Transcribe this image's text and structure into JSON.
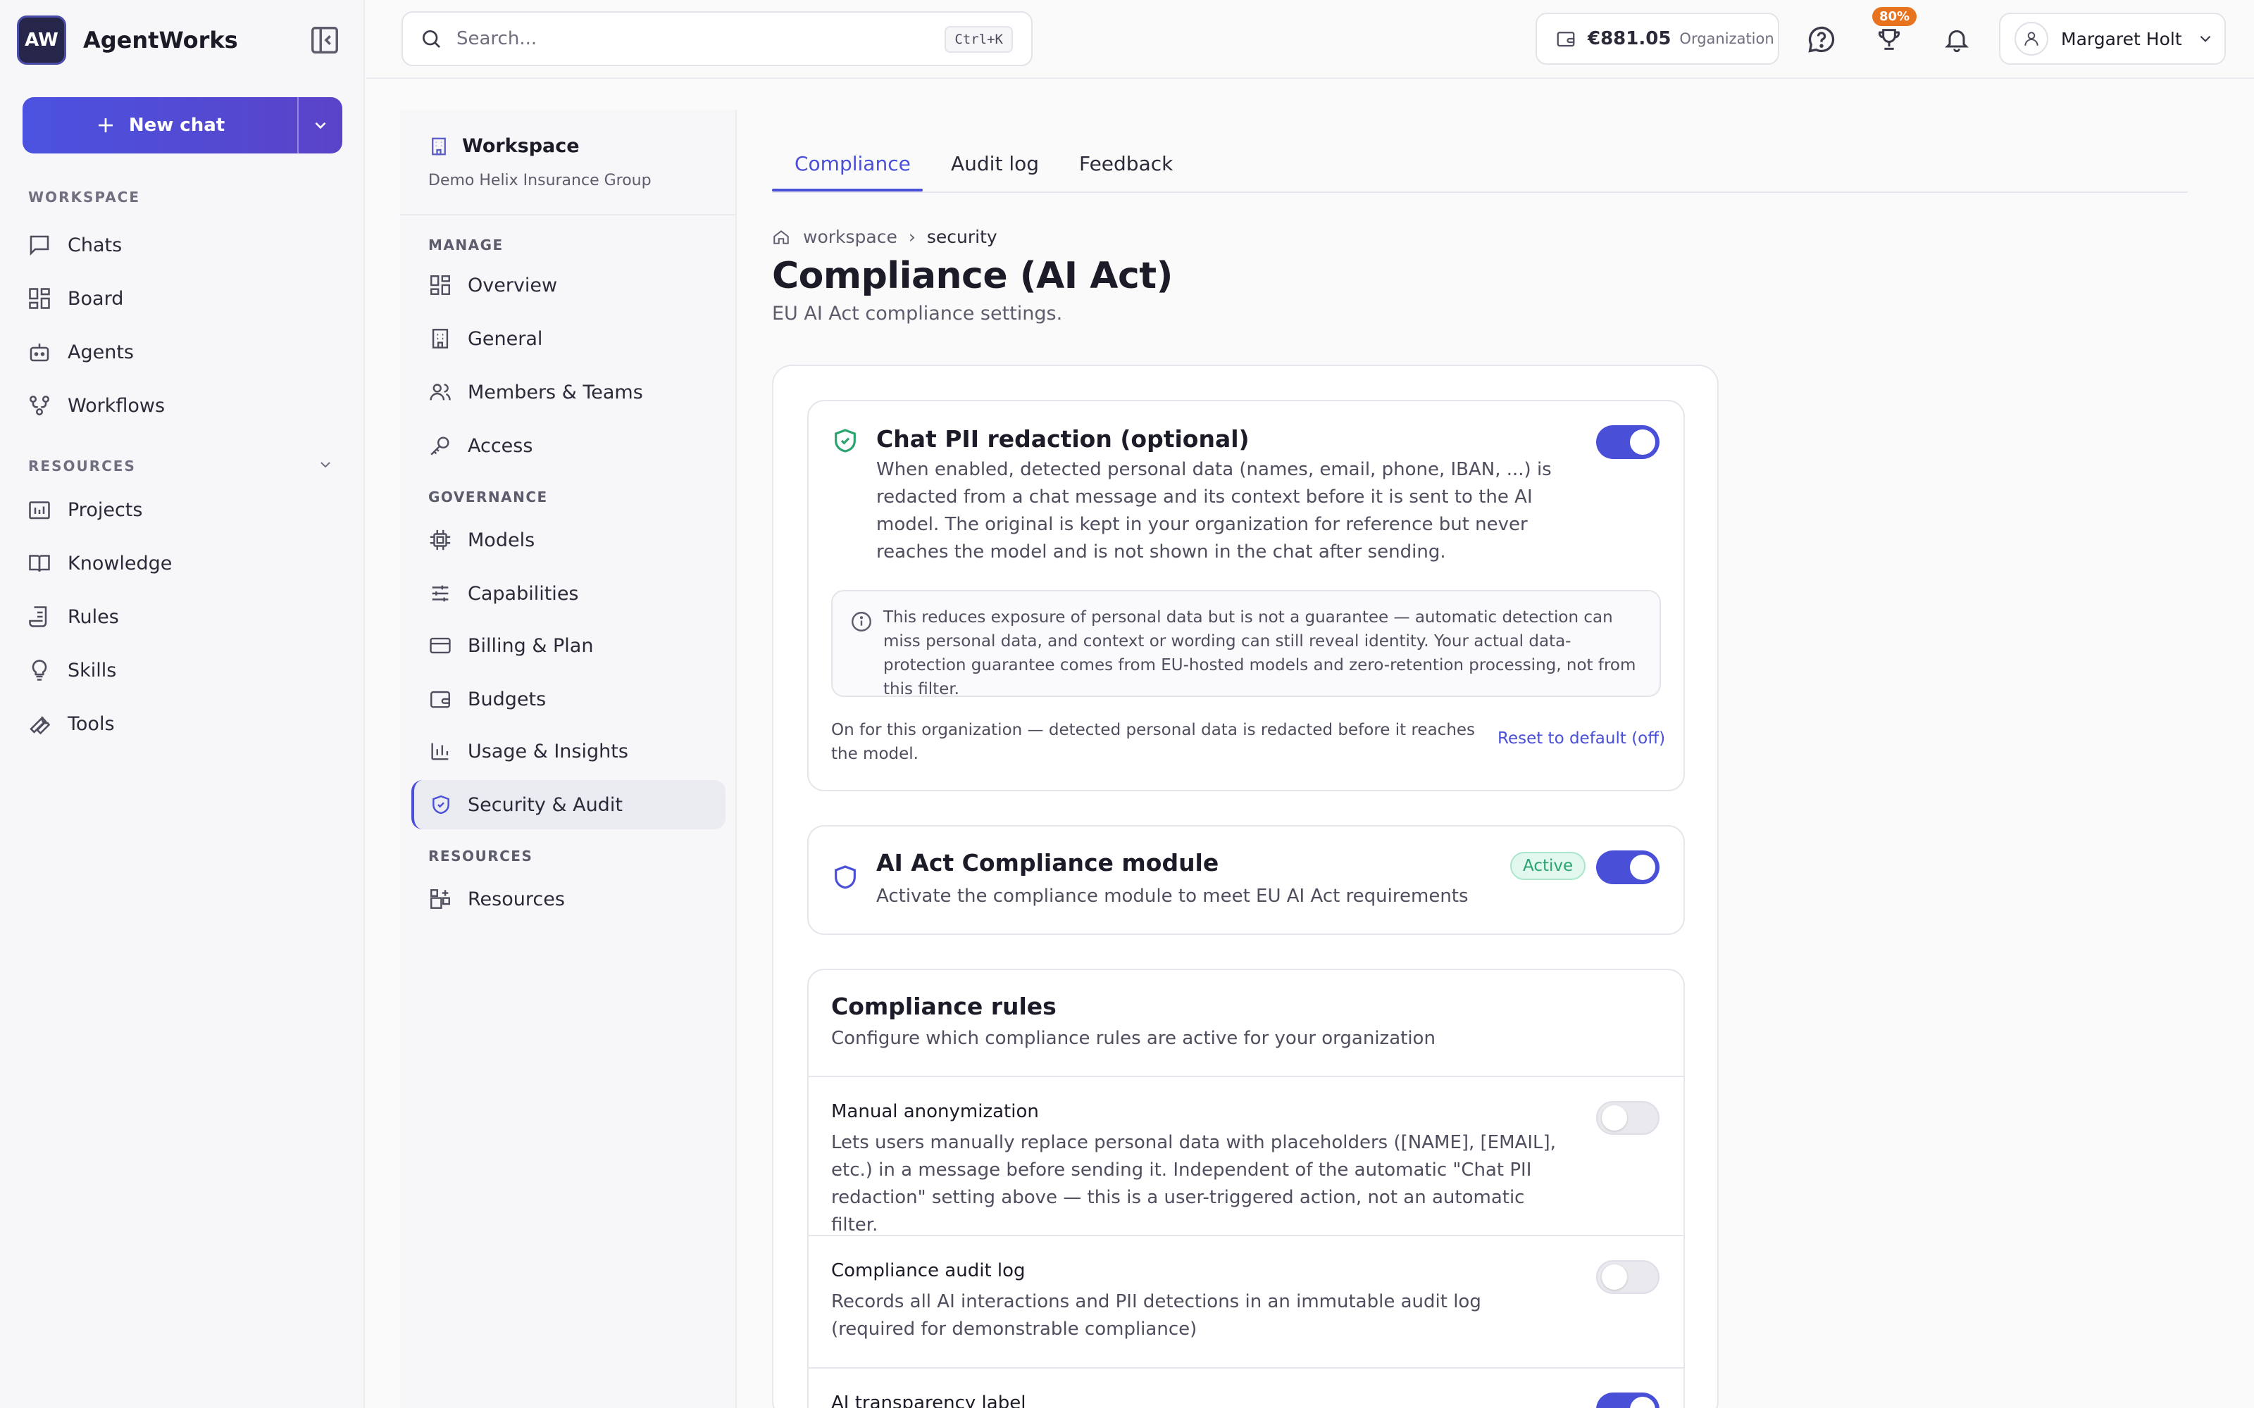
{
  "app": {
    "logo_text": "AW",
    "name": "AgentWorks"
  },
  "sidebar": {
    "new_chat_label": "New chat",
    "workspace_section": "WORKSPACE",
    "workspace_items": [
      "Chats",
      "Board",
      "Agents",
      "Workflows"
    ],
    "resources_section": "RESOURCES",
    "resources_items": [
      "Projects",
      "Knowledge",
      "Rules",
      "Skills",
      "Tools"
    ]
  },
  "topbar": {
    "search_placeholder": "Search...",
    "search_shortcut": "Ctrl+K",
    "balance_amount": "€881.05",
    "balance_scope": "Organization",
    "notification_badge": "80%",
    "user_name": "Margaret Holt"
  },
  "subnav": {
    "workspace_title": "Workspace",
    "workspace_org": "Demo Helix Insurance Group",
    "manage_section": "MANAGE",
    "manage_items": [
      "Overview",
      "General",
      "Members & Teams",
      "Access"
    ],
    "governance_section": "GOVERNANCE",
    "governance_items": [
      "Models",
      "Capabilities",
      "Billing & Plan",
      "Budgets",
      "Usage & Insights",
      "Security & Audit"
    ],
    "resources_section": "RESOURCES",
    "resources_items": [
      "Resources"
    ]
  },
  "tabs": [
    "Compliance",
    "Audit log",
    "Feedback"
  ],
  "breadcrumb": {
    "root": "workspace",
    "current": "security"
  },
  "page": {
    "title": "Compliance (AI Act)",
    "subtitle": "EU AI Act compliance settings."
  },
  "pii_card": {
    "title": "Chat PII redaction (optional)",
    "description": "When enabled, detected personal data (names, email, phone, IBAN, ...) is redacted from a chat message and its context before it is sent to the AI model. The original is kept in your organization for reference but never reaches the model and is not shown in the chat after sending.",
    "toggle_on": true,
    "info": "This reduces exposure of personal data but is not a guarantee — automatic detection can miss personal data, and context or wording can still reveal identity. Your actual data-protection guarantee comes from EU-hosted models and zero-retention processing, not from this filter.",
    "status": "On for this organization — detected personal data is redacted before it reaches the model.",
    "reset_label": "Reset to default (off)"
  },
  "module_card": {
    "title": "AI Act Compliance module",
    "description": "Activate the compliance module to meet EU AI Act requirements",
    "badge": "Active",
    "toggle_on": true
  },
  "rules_card": {
    "title": "Compliance rules",
    "subtitle": "Configure which compliance rules are active for your organization",
    "rules": [
      {
        "title": "Manual anonymization",
        "description": "Lets users manually replace personal data with placeholders ([NAME], [EMAIL], etc.) in a message before sending it. Independent of the automatic \"Chat PII redaction\" setting above — this is a user-triggered action, not an automatic filter.",
        "enabled": false
      },
      {
        "title": "Compliance audit log",
        "description": "Records all AI interactions and PII detections in an immutable audit log (required for demonstrable compliance)",
        "enabled": false
      },
      {
        "title": "AI transparency label",
        "description": "",
        "enabled": true
      }
    ]
  },
  "colors": {
    "accent": "#4a4fd8",
    "success": "#2aa46f",
    "warning_badge": "#e8731f"
  }
}
